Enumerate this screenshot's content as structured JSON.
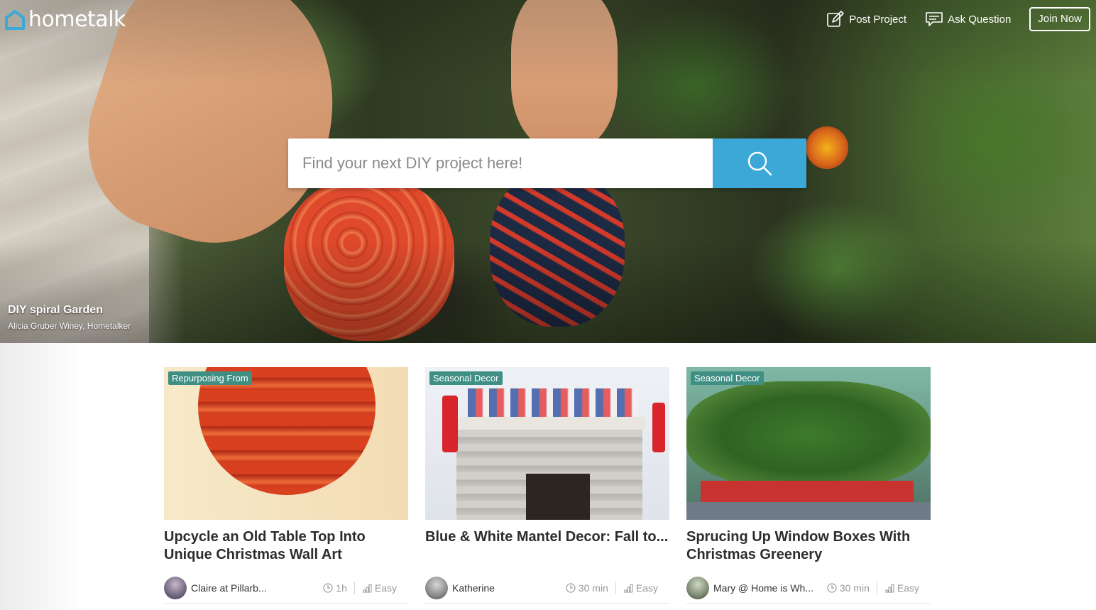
{
  "brand": {
    "name": "hometalk",
    "accent": "#3ba8d8"
  },
  "nav": {
    "post_project": "Post Project",
    "ask_question": "Ask Question",
    "join_now": "Join Now"
  },
  "search": {
    "placeholder": "Find your next DIY project here!"
  },
  "hero": {
    "title": "DIY spiral Garden",
    "author": "Alicia Gruber Winey, Hometalker"
  },
  "cards": [
    {
      "badge": "Repurposing From",
      "title": "Upcycle an Old Table Top Into Unique Christmas Wall Art",
      "author": "Claire at Pillarb...",
      "time": "1h",
      "difficulty": "Easy"
    },
    {
      "badge": "Seasonal Decor",
      "title": "Blue & White Mantel Decor: Fall to...",
      "author": "Katherine",
      "time": "30 min",
      "difficulty": "Easy"
    },
    {
      "badge": "Seasonal Decor",
      "title": "Sprucing Up Window Boxes With Christmas Greenery",
      "author": "Mary @ Home is Wh...",
      "time": "30 min",
      "difficulty": "Easy"
    }
  ]
}
